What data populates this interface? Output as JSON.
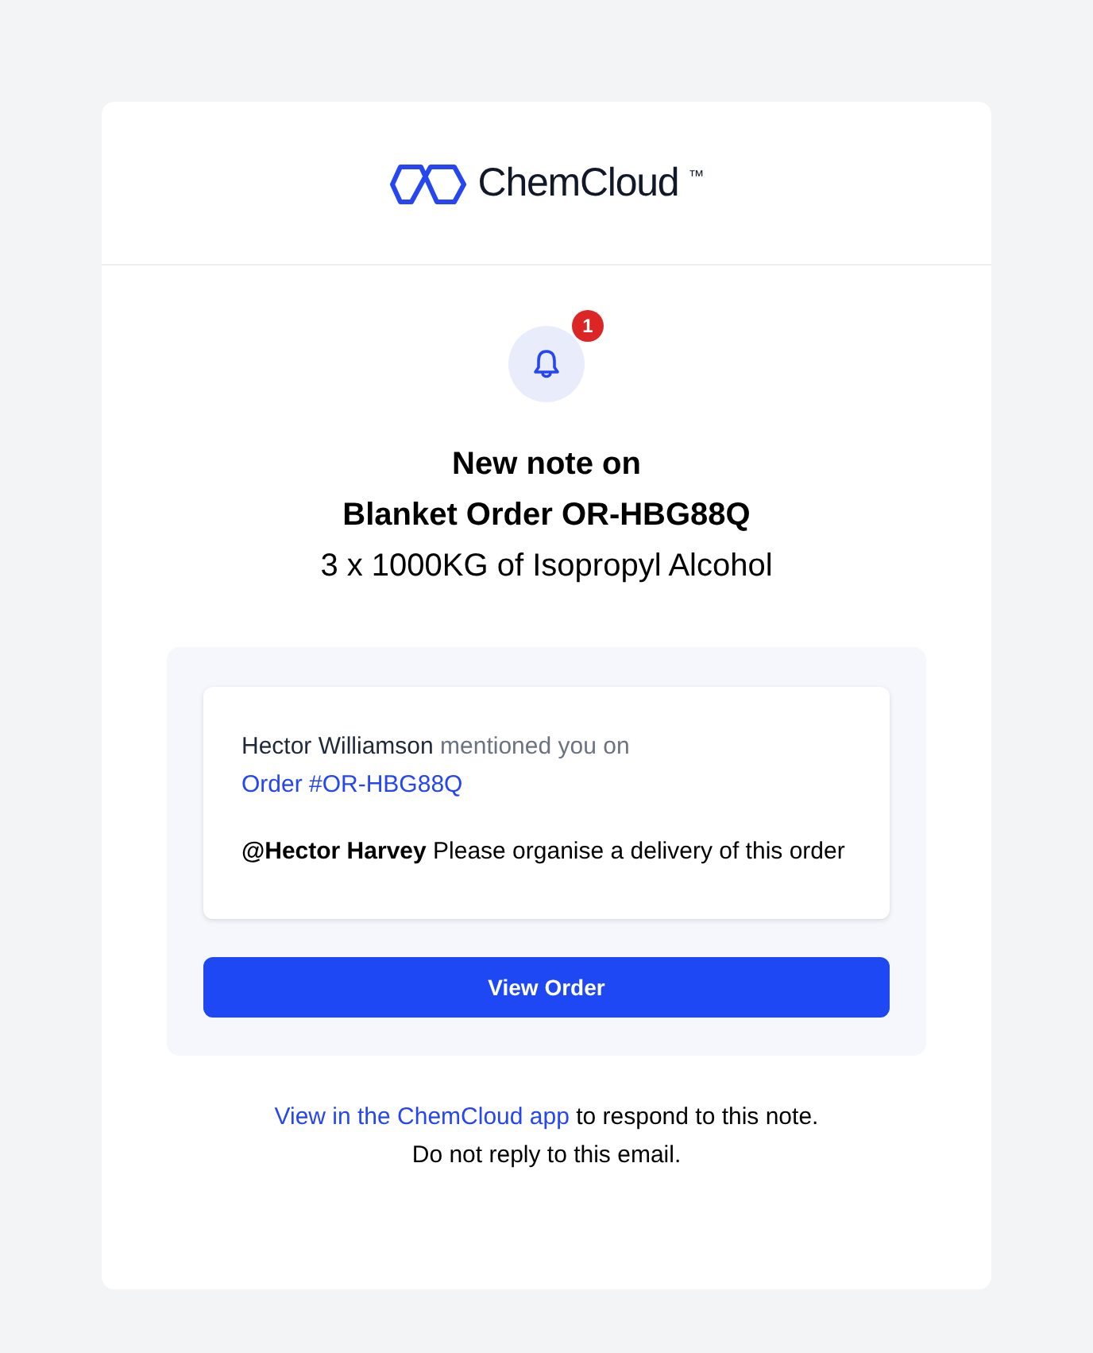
{
  "logo": {
    "name": "ChemCloud",
    "trademark": "™"
  },
  "notification": {
    "badge": "1"
  },
  "heading": {
    "line_1": "New note on",
    "line_2": "Blanket Order OR-HBG88Q",
    "subtitle": "3 x 1000KG of Isopropyl Alcohol"
  },
  "note": {
    "author": "Hector Williamson",
    "action": "mentioned you on",
    "link": "Order #OR-HBG88Q",
    "message": "**@Hector Harvey** Please organise a delivery of this order"
  },
  "button": "View Order",
  "footer": {
    "link": "View in the ChemCloud app",
    "text": " to respond to this note.",
    "notice": "Do not reply to this email."
  }
}
